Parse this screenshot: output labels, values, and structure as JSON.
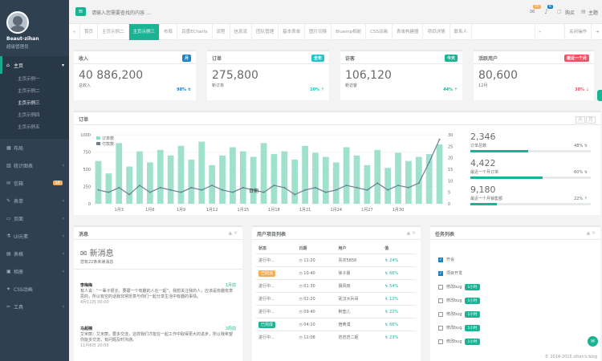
{
  "sidebar": {
    "username": "Beaut-zihan",
    "role": "超级管理员",
    "items": [
      {
        "label": "主页",
        "icon": "home-icon",
        "active": true
      },
      {
        "label": "布局",
        "icon": "layout-icon"
      },
      {
        "label": "统计图表",
        "icon": "chart-icon"
      },
      {
        "label": "信箱",
        "icon": "mail-icon",
        "badge": "16"
      },
      {
        "label": "表单",
        "icon": "edit-icon"
      },
      {
        "label": "页面",
        "icon": "desktop-icon"
      },
      {
        "label": "UI元素",
        "icon": "flask-icon"
      },
      {
        "label": "表格",
        "icon": "table-icon"
      },
      {
        "label": "相册",
        "icon": "picture-icon"
      },
      {
        "label": "CSS动画",
        "icon": "magic-icon"
      },
      {
        "label": "工具",
        "icon": "cutlery-icon"
      }
    ],
    "subitems": [
      "主页示例一",
      "主页示例二",
      "主页示例三",
      "主页示例四",
      "主页示例五"
    ]
  },
  "topbar": {
    "search_placeholder": "请输入您需要查找的内容 …",
    "mail_badge": "16",
    "bell_badge": "8",
    "theme_label": "购买",
    "theme2_label": "主题"
  },
  "tabs": [
    "首页",
    "主页示例二",
    "主页示例三",
    "布局",
    "百度ECharts",
    "流程",
    "信息流",
    "团队管理",
    "基本表单",
    "图片切换",
    "Bluemp相册",
    "CSS动画",
    "表单构建器",
    "项目详情",
    "联系人"
  ],
  "tab_close_menu": "关闭操作",
  "stats": [
    {
      "title": "收入",
      "label": "月",
      "label_color": "#1c84c6",
      "value": "40 886,200",
      "sub": "总收入",
      "pct": "98%"
    },
    {
      "title": "订单",
      "label": "全年",
      "label_color": "#23c6c8",
      "value": "275,800",
      "sub": "新订单",
      "pct": "20%"
    },
    {
      "title": "访客",
      "label": "今天",
      "label_color": "#1ab394",
      "value": "106,120",
      "sub": "新访客",
      "pct": "44%"
    },
    {
      "title": "活跃用户",
      "label": "最近一个月",
      "label_color": "#ed5565",
      "value": "80,600",
      "sub": "12月",
      "pct": "38%"
    }
  ],
  "chart_panel": {
    "title": "订单",
    "btn_day": "天",
    "btn_month": "月",
    "kpis": [
      {
        "value": "2,346",
        "sub": "订单总数",
        "pct": "48%"
      },
      {
        "value": "4,422",
        "sub": "最近一个月订单",
        "pct": "60%"
      },
      {
        "value": "9,180",
        "sub": "最近一个月销售额",
        "pct": "22%"
      }
    ]
  },
  "chart_data": {
    "type": "bar",
    "legend": [
      "订单数",
      "付款数"
    ],
    "x_ticks": [
      "1月3",
      "1月6",
      "1月9",
      "1月12",
      "1月15",
      "1月18",
      "1月21",
      "1月24",
      "1月27",
      "1月30"
    ],
    "y_left_ticks": [
      "0",
      "250",
      "500",
      "750",
      "1000"
    ],
    "y_right_ticks": [
      "0",
      "5",
      "10",
      "15",
      "20",
      "25",
      "30"
    ],
    "ylim_left": [
      0,
      1000
    ],
    "ylim_right": [
      0,
      30
    ],
    "series": [
      {
        "name": "订单数",
        "type": "bar",
        "color": "#8fdcc5",
        "values": [
          620,
          440,
          880,
          540,
          760,
          600,
          780,
          700,
          840,
          640,
          900,
          560,
          700,
          820,
          760,
          680,
          880,
          720,
          760,
          640,
          840,
          740,
          680,
          600,
          820,
          700,
          560,
          780,
          520,
          740,
          620,
          680,
          720,
          860
        ]
      },
      {
        "name": "付款数",
        "type": "line",
        "color": "#6b7f90",
        "values": [
          6,
          5,
          7,
          4,
          8,
          5,
          7,
          6,
          5,
          7,
          6,
          8,
          6,
          5,
          7,
          6,
          5,
          8,
          7,
          4,
          6,
          7,
          5,
          6,
          8,
          7,
          6,
          9,
          6,
          8,
          7,
          9,
          18,
          28
        ]
      }
    ],
    "annotation": "日期"
  },
  "messages": {
    "title": "消息",
    "header": "新消息",
    "subheader": "您有22条未读消息",
    "items": [
      {
        "name": "李梅梅",
        "date": "1月前",
        "text": "有人说：“一辈子很长，要跟一个有趣的人在一起”。我想关注我的人，应该是有趣有意思的，所以有空的话我非常愿意与你们一起分享生活中有趣的事情。",
        "time": "4月11日 00:00"
      },
      {
        "name": "马超楠",
        "date": "3周前",
        "text": "艾米丽：艾米丽，要多交流，这样我们才能在一起工作中取得更大的进步，所以我希望你能多交流，有问题及时沟通。",
        "time": "11月6日 20:00"
      }
    ]
  },
  "projects": {
    "title": "用户项目列表",
    "headers": [
      "状态",
      "日期",
      "用户",
      "值"
    ],
    "rows": [
      {
        "status": "进行中...",
        "tag": "",
        "date": "11:20",
        "user": "青衣5858",
        "value": "24%"
      },
      {
        "status": "已取消",
        "tag": "warn",
        "date": "10:40",
        "user": "徐子晨",
        "value": "66%"
      },
      {
        "status": "进行中...",
        "tag": "",
        "date": "01:30",
        "user": "晨风晓",
        "value": "54%"
      },
      {
        "status": "进行中...",
        "tag": "",
        "date": "02:20",
        "user": "武汉大兵哥",
        "value": "12%"
      },
      {
        "status": "进行中...",
        "tag": "",
        "date": "09:40",
        "user": "荆莹儿",
        "value": "22%"
      },
      {
        "status": "已完成",
        "tag": "done",
        "date": "04:10",
        "user": "宿黄漠",
        "value": "66%"
      },
      {
        "status": "进行中...",
        "tag": "",
        "date": "12:08",
        "user": "范范范二妮",
        "value": "23%"
      }
    ]
  },
  "tasks": {
    "title": "任务列表",
    "items": [
      {
        "label": "开会",
        "checked": true,
        "tag": ""
      },
      {
        "label": "项目开发",
        "checked": true,
        "tag": ""
      },
      {
        "label": "修改bug",
        "checked": false,
        "tag": "1小时"
      },
      {
        "label": "修改bug",
        "checked": false,
        "tag": "1小时"
      },
      {
        "label": "修改bug",
        "checked": false,
        "tag": "1小时"
      },
      {
        "label": "修改bug",
        "checked": false,
        "tag": "1小时"
      },
      {
        "label": "修改bug",
        "checked": false,
        "tag": "1小时"
      }
    ]
  },
  "footer": "© 2014-2015 zihan's blog"
}
